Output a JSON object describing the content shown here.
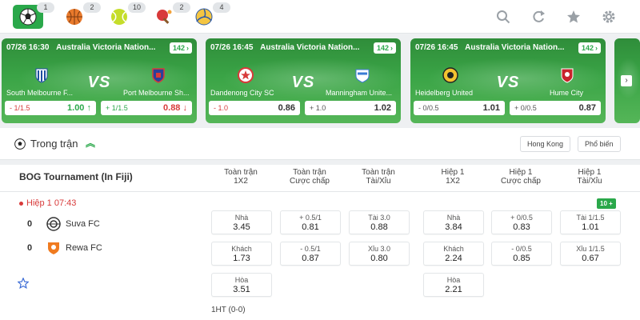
{
  "topbar": {
    "sports": [
      {
        "name": "soccer",
        "count": "1",
        "active": true
      },
      {
        "name": "basketball",
        "count": "2",
        "active": false
      },
      {
        "name": "tennis",
        "count": "10",
        "active": false
      },
      {
        "name": "table-tennis",
        "count": "2",
        "active": false
      },
      {
        "name": "volleyball",
        "count": "4",
        "active": false
      }
    ],
    "tools": [
      "search-icon",
      "refresh-icon",
      "star-icon",
      "gear-icon"
    ]
  },
  "cards": [
    {
      "datetime": "07/26 16:30",
      "league": "Australia Victoria Nation...",
      "markets": "142",
      "home": "South Melbourne F...",
      "away": "Port Melbourne Sh...",
      "odd_home": {
        "handicap": "- 1/1.5",
        "value": "1.00",
        "trend": "up"
      },
      "odd_away": {
        "handicap": "+ 1/1.5",
        "value": "0.88",
        "trend": "down"
      }
    },
    {
      "datetime": "07/26 16:45",
      "league": "Australia Victoria Nation...",
      "markets": "142",
      "home": "Dandenong City SC",
      "away": "Manningham Unite...",
      "odd_home": {
        "handicap": "- 1.0",
        "value": "0.86",
        "trend": "none"
      },
      "odd_away": {
        "handicap": "+ 1.0",
        "value": "1.02",
        "trend": "none"
      }
    },
    {
      "datetime": "07/26 16:45",
      "league": "Australia Victoria Nation...",
      "markets": "142",
      "home": "Heidelberg United",
      "away": "Hume City",
      "odd_home": {
        "handicap": "- 0/0.5",
        "value": "1.01",
        "trend": "none"
      },
      "odd_away": {
        "handicap": "+ 0/0.5",
        "value": "0.87",
        "trend": "none"
      }
    }
  ],
  "card_vs": "VS",
  "section": {
    "title": "Trong trận",
    "buttons": [
      "Hong Kong",
      "Phổ biến"
    ]
  },
  "league": {
    "name": "BOG Tournament (In Fiji)",
    "columns": [
      [
        "Toàn trận",
        "1X2"
      ],
      [
        "Toàn trận",
        "Cược chấp"
      ],
      [
        "Toàn trận",
        "Tài/Xỉu"
      ],
      [
        "Hiệp 1",
        "1X2"
      ],
      [
        "Hiệp 1",
        "Cược chấp"
      ],
      [
        "Hiệp 1",
        "Tài/Xỉu"
      ]
    ],
    "match": {
      "status": "Hiệp 1 07:43",
      "more_markets": "10 +",
      "home": {
        "name": "Suva FC",
        "score": "0"
      },
      "away": {
        "name": "Rewa FC",
        "score": "0"
      },
      "halftime": "1HT  (0-0)",
      "odds": {
        "ft_1x2": [
          {
            "label": "Nhà",
            "value": "3.45"
          },
          {
            "label": "Khách",
            "value": "1.73"
          },
          {
            "label": "Hòa",
            "value": "3.51"
          }
        ],
        "ft_hdp": [
          {
            "label": "+ 0.5/1",
            "value": "0.81"
          },
          {
            "label": "- 0.5/1",
            "value": "0.87"
          }
        ],
        "ft_ou": [
          {
            "label": "Tài 3.0",
            "value": "0.88"
          },
          {
            "label": "Xỉu 3.0",
            "value": "0.80"
          }
        ],
        "h1_1x2": [
          {
            "label": "Nhà",
            "value": "3.84"
          },
          {
            "label": "Khách",
            "value": "2.24"
          },
          {
            "label": "Hòa",
            "value": "2.21"
          }
        ],
        "h1_hdp": [
          {
            "label": "+ 0/0.5",
            "value": "0.83"
          },
          {
            "label": "- 0/0.5",
            "value": "0.85"
          }
        ],
        "h1_ou": [
          {
            "label": "Tài 1/1.5",
            "value": "1.01"
          },
          {
            "label": "Xỉu 1/1.5",
            "value": "0.67"
          }
        ]
      }
    }
  },
  "colors": {
    "accent": "#2aa84a",
    "live": "#d83a3a",
    "card_green": "#3aa446"
  }
}
